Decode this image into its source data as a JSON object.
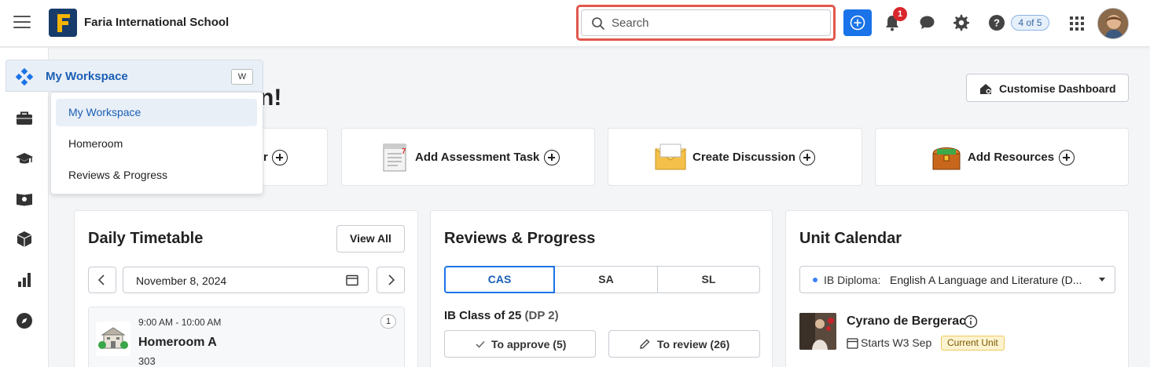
{
  "topbar": {
    "school_name": "Faria International School",
    "search_placeholder": "Search",
    "notification_count": "1",
    "page_count": "4 of 5"
  },
  "workspace_menu": {
    "header_label": "My Workspace",
    "shortcut_key": "W",
    "items": [
      {
        "label": "My Workspace",
        "active": true
      },
      {
        "label": "Homeroom",
        "active": false
      },
      {
        "label": "Reviews & Progress",
        "active": false
      }
    ]
  },
  "dashboard": {
    "greeting_tail": "n!",
    "customise_label": "Customise Dashboard"
  },
  "quick_actions": [
    {
      "label": "r"
    },
    {
      "label": "Add Assessment Task"
    },
    {
      "label": "Create Discussion"
    },
    {
      "label": "Add Resources"
    }
  ],
  "daily_timetable": {
    "title": "Daily Timetable",
    "view_all_label": "View All",
    "date": "November 8, 2024",
    "entry": {
      "time": "9:00 AM - 10:00 AM",
      "name": "Homeroom A",
      "room": "303",
      "count": "1"
    }
  },
  "reviews_progress": {
    "title": "Reviews & Progress",
    "tabs": [
      "CAS",
      "SA",
      "SL"
    ],
    "active_tab": "CAS",
    "class_name": "IB Class of 25",
    "class_sub": "(DP 2)",
    "approve_label": "To approve (5)",
    "review_label": "To review (26)"
  },
  "unit_calendar": {
    "title": "Unit Calendar",
    "select_prefix": "IB Diploma:",
    "select_value": "English A Language and Literature (D...",
    "unit_title": "Cyrano de Bergerac",
    "unit_start": "Starts W3 Sep",
    "unit_badge": "Current Unit"
  },
  "colors": {
    "accent": "#1a73e8",
    "search_highlight": "#e1574c",
    "badge_red": "#d9262c"
  }
}
